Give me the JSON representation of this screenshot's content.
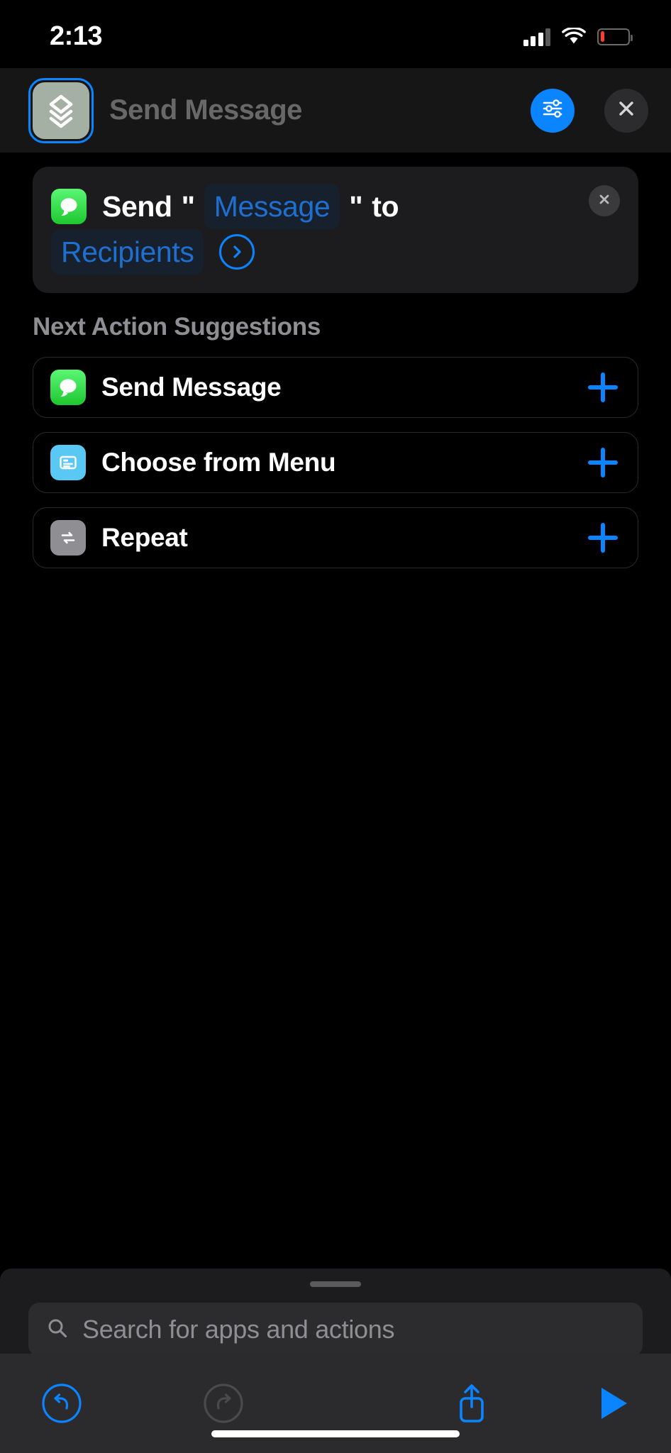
{
  "status_bar": {
    "time": "2:13",
    "cellular_icon": "cellular-bars-icon",
    "wifi_icon": "wifi-icon",
    "battery_icon": "battery-low-icon",
    "battery_level_percent": 15
  },
  "navbar": {
    "shortcut_icon": "stacked-layers-icon",
    "title": "Send Message",
    "settings_icon": "sliders-icon",
    "close_icon": "close-x-icon"
  },
  "action_card": {
    "app_icon": "messages-icon",
    "prefix": "Send",
    "quote_open": "\"",
    "message_token": "Message",
    "quote_close": "\"",
    "connector": "to",
    "recipients_token": "Recipients",
    "expand_icon": "chevron-right-circle-icon",
    "remove_icon": "close-x-icon"
  },
  "suggestions": {
    "header": "Next Action Suggestions",
    "items": [
      {
        "label": "Send Message",
        "icon": "messages-icon",
        "add_icon": "plus-icon"
      },
      {
        "label": "Choose from Menu",
        "icon": "menu-list-icon",
        "add_icon": "plus-icon"
      },
      {
        "label": "Repeat",
        "icon": "repeat-arrows-icon",
        "add_icon": "plus-icon"
      }
    ]
  },
  "sheet": {
    "grabber": "drag-handle",
    "search_placeholder": "Search for apps and actions",
    "search_value": "",
    "search_icon": "search-icon"
  },
  "toolbar": {
    "undo_icon": "undo-arrow-icon",
    "redo_icon": "redo-arrow-icon",
    "share_icon": "share-icon",
    "play_icon": "play-icon"
  },
  "colors": {
    "accent_blue": "#0a84ff",
    "token_blue": "#1f6fd0",
    "token_bg": "#17212e",
    "messages_green": "#1ec72f",
    "menu_blue": "#5ac8f5",
    "repeat_gray": "#8e8e93",
    "card_bg": "#1c1c1e",
    "battery_red": "#ff3b30"
  }
}
